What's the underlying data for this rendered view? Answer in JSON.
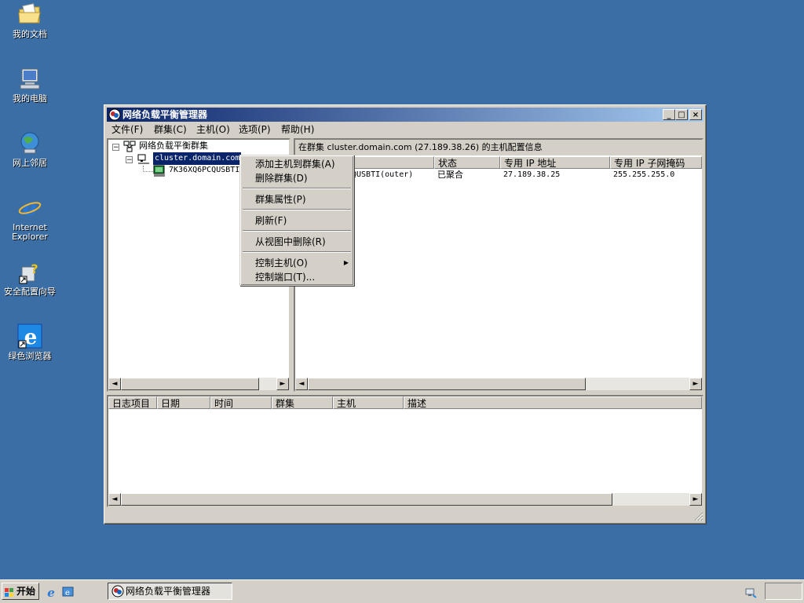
{
  "desktop": {
    "icons": [
      {
        "label": "我的文档",
        "icon": "my-documents-folder"
      },
      {
        "label": "我的电脑",
        "icon": "my-computer"
      },
      {
        "label": "网上邻居",
        "icon": "network-places"
      },
      {
        "label": "Internet Explorer",
        "icon": "internet-explorer"
      },
      {
        "label": "安全配置向导",
        "icon": "security-wizard"
      },
      {
        "label": "绿色浏览器",
        "icon": "green-browser"
      }
    ]
  },
  "window": {
    "title": "网络负载平衡管理器",
    "controls": {
      "minimize": "_",
      "maximize": "□",
      "close": "×"
    },
    "menu": [
      "文件(F)",
      "群集(C)",
      "主机(O)",
      "选项(P)",
      "帮助(H)"
    ],
    "tree": {
      "root": "网络负载平衡群集",
      "cluster": "cluster.domain.com",
      "host": "7K36XQ6PCQUSBTI"
    },
    "detail": {
      "caption": "在群集 cluster.domain.com (27.189.38.26) 的主机配置信息",
      "columns": [
        "",
        "状态",
        "专用 IP 地址",
        "专用 IP 子网掩码"
      ],
      "rows": [
        {
          "host": "QUSBTI(outer)",
          "status": "已聚合",
          "ip": "27.189.38.25",
          "mask": "255.255.255.0"
        }
      ]
    },
    "log": {
      "columns": [
        "日志项目",
        "日期",
        "时间",
        "群集",
        "主机",
        "描述"
      ]
    },
    "context_menu": [
      "添加主机到群集(A)",
      "删除群集(D)",
      "群集属性(P)",
      "刷新(F)",
      "从视图中删除(R)",
      "控制主机(O)",
      "控制端口(T)..."
    ]
  },
  "taskbar": {
    "start": "开始",
    "task": "网络负载平衡管理器"
  }
}
